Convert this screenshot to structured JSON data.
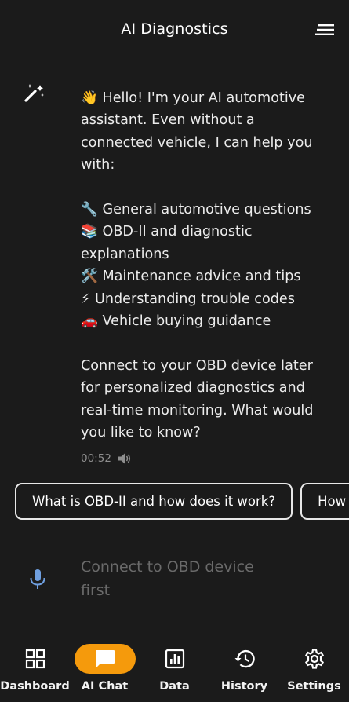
{
  "header": {
    "title": "AI Diagnostics"
  },
  "message": {
    "text": "👋 Hello! I'm your AI automotive assistant. Even without a connected vehicle, I can help you with:\n\n🔧 General automotive questions\n📚 OBD-II and diagnostic explanations\n🛠️ Maintenance advice and tips\n⚡ Understanding trouble codes\n🚗 Vehicle buying guidance\n\nConnect to your OBD device later for personalized diagnostics and real-time monitoring. What would you like to know?",
    "time": "00:52"
  },
  "suggestions": [
    "What is OBD-II and how does it work?",
    "How often should I change my oil?"
  ],
  "input": {
    "placeholder": "Connect to OBD device first"
  },
  "nav": {
    "items": [
      {
        "label": "Dashboard",
        "icon": "dashboard-icon"
      },
      {
        "label": "AI Chat",
        "icon": "chat-icon",
        "active": true
      },
      {
        "label": "Data",
        "icon": "data-icon"
      },
      {
        "label": "History",
        "icon": "history-icon"
      },
      {
        "label": "Settings",
        "icon": "settings-icon"
      }
    ]
  },
  "colors": {
    "background": "#1b1b1b",
    "accent": "#f59a0c",
    "mic": "#6f9fe0"
  }
}
